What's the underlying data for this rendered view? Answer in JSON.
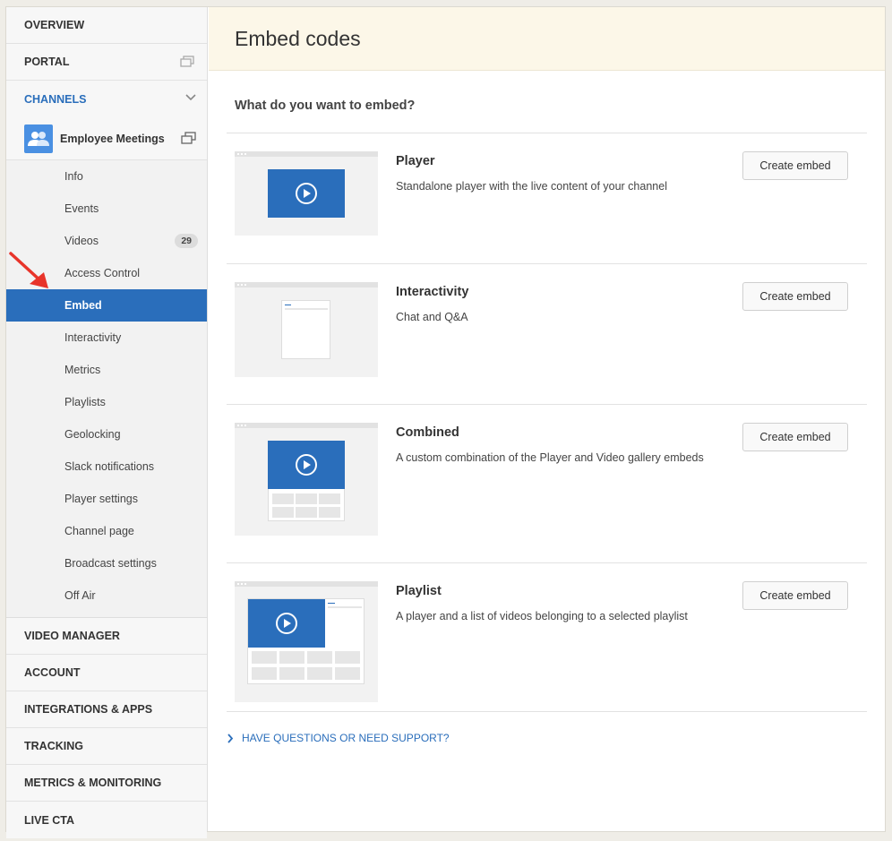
{
  "sidebar": {
    "top_items": [
      {
        "label": "OVERVIEW"
      },
      {
        "label": "PORTAL"
      },
      {
        "label": "CHANNELS"
      }
    ],
    "channel": {
      "name": "Employee Meetings"
    },
    "sub_items": [
      {
        "label": "Info"
      },
      {
        "label": "Events"
      },
      {
        "label": "Videos",
        "badge": "29"
      },
      {
        "label": "Access Control"
      },
      {
        "label": "Embed",
        "active": true
      },
      {
        "label": "Interactivity"
      },
      {
        "label": "Metrics"
      },
      {
        "label": "Playlists"
      },
      {
        "label": "Geolocking"
      },
      {
        "label": "Slack notifications"
      },
      {
        "label": "Player settings"
      },
      {
        "label": "Channel page"
      },
      {
        "label": "Broadcast settings"
      },
      {
        "label": "Off Air"
      }
    ],
    "bottom_items": [
      {
        "label": "VIDEO MANAGER"
      },
      {
        "label": "ACCOUNT"
      },
      {
        "label": "INTEGRATIONS & APPS"
      },
      {
        "label": "TRACKING"
      },
      {
        "label": "METRICS & MONITORING"
      },
      {
        "label": "LIVE CTA"
      }
    ]
  },
  "main": {
    "title": "Embed codes",
    "question": "What do you want to embed?",
    "cards": [
      {
        "title": "Player",
        "description": "Standalone player with the live content of your channel",
        "button": "Create embed"
      },
      {
        "title": "Interactivity",
        "description": "Chat and Q&A",
        "button": "Create embed"
      },
      {
        "title": "Combined",
        "description": "A custom combination of the Player and Video gallery embeds",
        "button": "Create embed"
      },
      {
        "title": "Playlist",
        "description": "A player and a list of videos belonging to a selected playlist",
        "button": "Create embed"
      }
    ],
    "support_link": "HAVE QUESTIONS OR NEED SUPPORT?"
  },
  "colors": {
    "accent": "#2a6ebb",
    "header_bg": "#fcf7e8",
    "video_blue": "#2a6ebb",
    "arrow": "#e8342a"
  }
}
